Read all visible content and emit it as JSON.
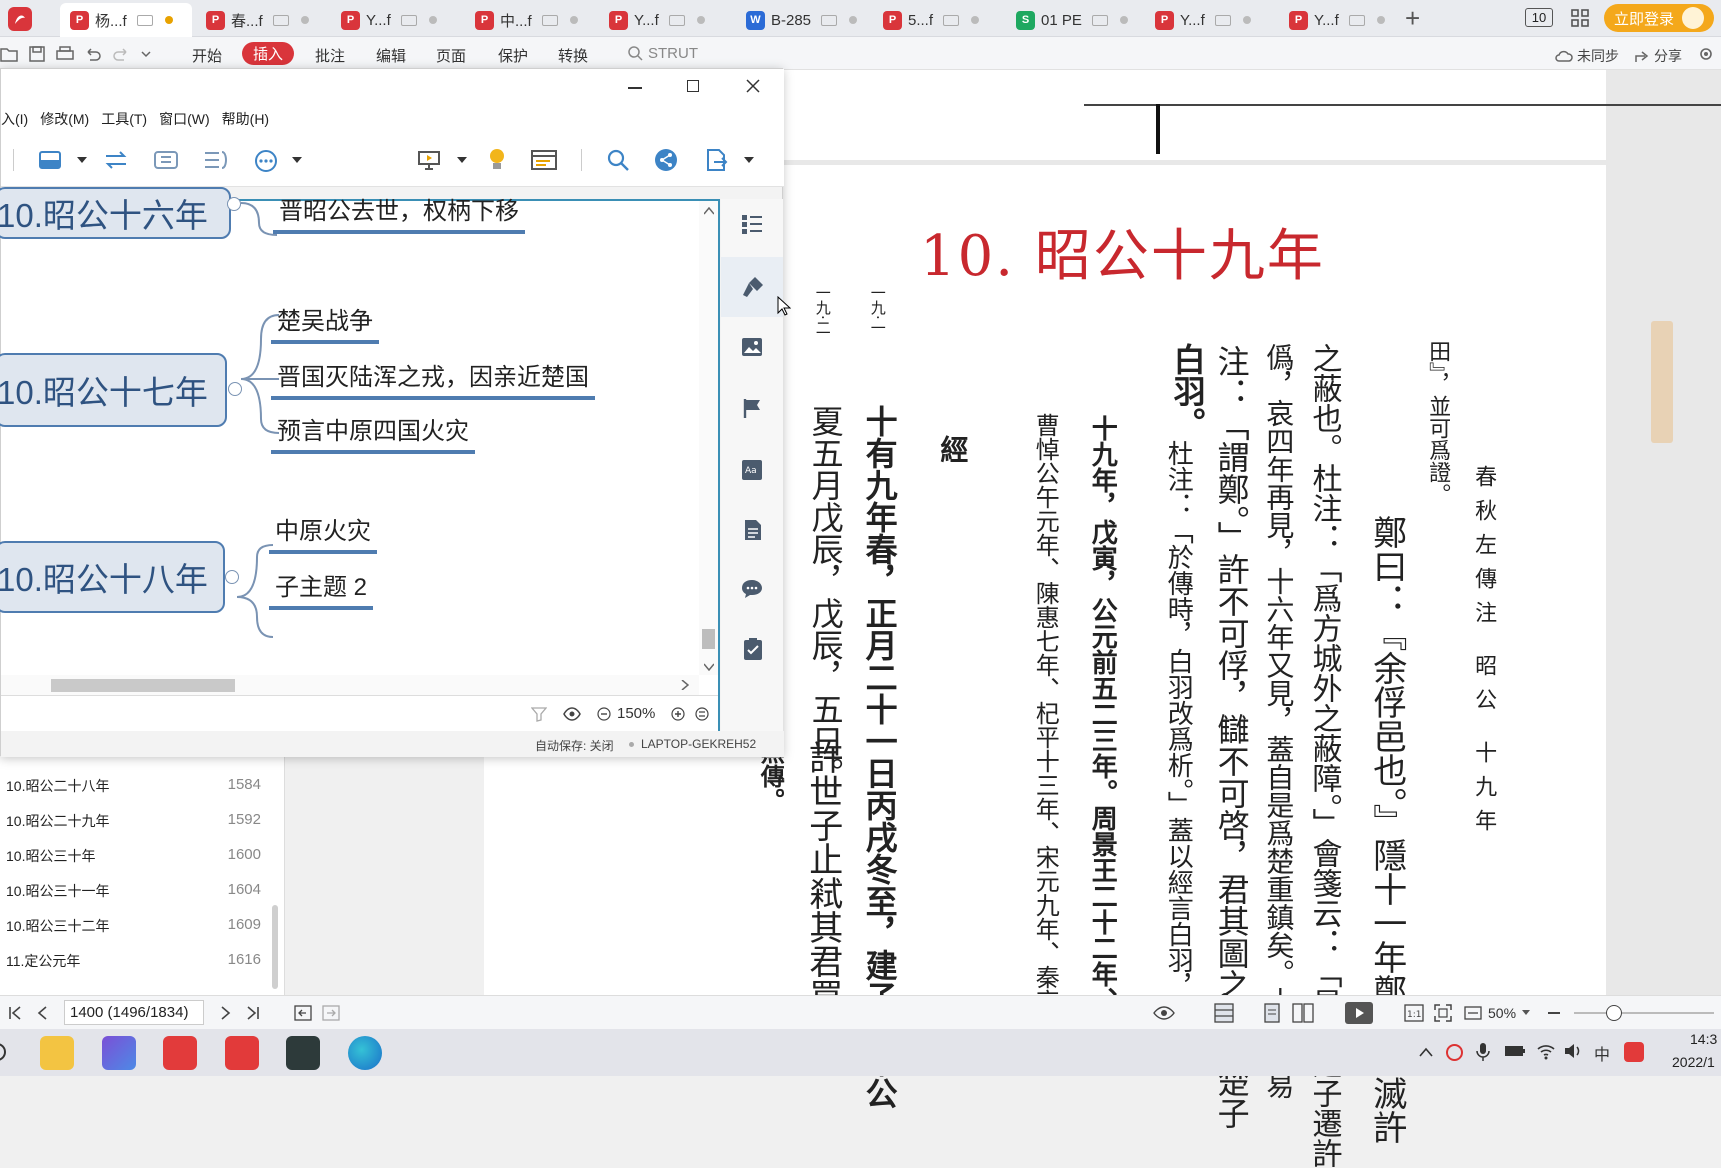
{
  "tabs": [
    {
      "label": "杨...f",
      "type": "pdf",
      "active": true
    },
    {
      "label": "春...f",
      "type": "pdf"
    },
    {
      "label": "Y...f",
      "type": "pdf"
    },
    {
      "label": "中...f",
      "type": "pdf"
    },
    {
      "label": "Y...f",
      "type": "pdf"
    },
    {
      "label": "B-285",
      "type": "word"
    },
    {
      "label": "5...f",
      "type": "pdf"
    },
    {
      "label": "01 PE",
      "type": "sheet"
    },
    {
      "label": "Y...f",
      "type": "pdf"
    },
    {
      "label": "Y...f",
      "type": "pdf"
    }
  ],
  "tabbar": {
    "page_count": "10",
    "login_label": "立即登录"
  },
  "ribbon": {
    "start": "开始",
    "insert": "插入",
    "annotate": "批注",
    "edit": "编辑",
    "page": "页面",
    "protect": "保护",
    "convert": "转换",
    "search": "STRUT",
    "sync": "未同步",
    "share": "分享"
  },
  "xmind": {
    "menu": [
      "入(I)",
      "修改(M)",
      "工具(T)",
      "窗口(W)",
      "帮助(H)"
    ],
    "nodes": {
      "n16": "10.昭公十六年",
      "n16_sub": "晋昭公去世，权柄下移",
      "n17": "10.昭公十七年",
      "n17_subs": [
        "楚吴战争",
        "晋国灭陆浑之戎，因亲近楚国",
        "预言中原四国火灾"
      ],
      "n18": "10.昭公十八年",
      "n18_subs": [
        "中原火灾",
        "子主题 2"
      ]
    },
    "zoom": "150%",
    "autosave": "自动保存: 关闭",
    "computer": "LAPTOP-GEKREH52"
  },
  "outline": {
    "items": [
      {
        "label": "10.昭公二十八年",
        "page": "1584"
      },
      {
        "label": "10.昭公二十九年",
        "page": "1592"
      },
      {
        "label": "10.昭公三十年",
        "page": "1600"
      },
      {
        "label": "10.昭公三十一年",
        "page": "1604"
      },
      {
        "label": "10.昭公三十二年",
        "page": "1609"
      },
      {
        "label": "11.定公元年",
        "page": "1616"
      }
    ]
  },
  "document": {
    "title": "10. 昭公十九年",
    "side_marks": [
      "一九·一",
      "一九·二"
    ],
    "header": "春秋左傳注  昭公  十九年",
    "jing": "經",
    "col_year": "十九年，戊寅，公元前五二三年。周景王二十二年、晉頃",
    "col_states": "曹悼公午元年、陳惠七年、杞平十三年、宋元九年、秦哀",
    "col_spring": "十有九年春，正月二十一日丙戌冬至，建子。宋公",
    "col_summer": "夏五月戊辰，戊辰，五日。",
    "col_xu": "許世子止弒其君買",
    "col_wuzhuan": "無傳。",
    "c1": "田』，並可爲證。",
    "c2": "鄭曰：『余俘邑也。』隱十一年鄭莊公滅許",
    "c3": "之蔽也。杜注：「爲方城外之蔽障。」會箋云：「是年楚子遷許",
    "c4": "僞，哀四年再見，十六年又見，蓋自是爲楚重鎮矣。土不可易",
    "c5": "注：「謂鄭。」許不可俘，讎不可啓，君其圖之！』楚子",
    "c6": "杜注：「於傳時，白羽改爲析。」蓋以經言白羽，則白羽",
    "c7": "白羽。"
  },
  "statusbar": {
    "page_input": "1400 (1496/1834)",
    "zoom": "50%"
  },
  "taskbar": {
    "time": "14:3",
    "date": "2022/1",
    "ime": "中"
  },
  "colors": {
    "accent": "#d9353b",
    "xmind_node": "#dfe6ef",
    "xmind_border": "#4f7cb0",
    "xmind_frame": "#3a8fb5",
    "title_red": "#c8282e"
  }
}
